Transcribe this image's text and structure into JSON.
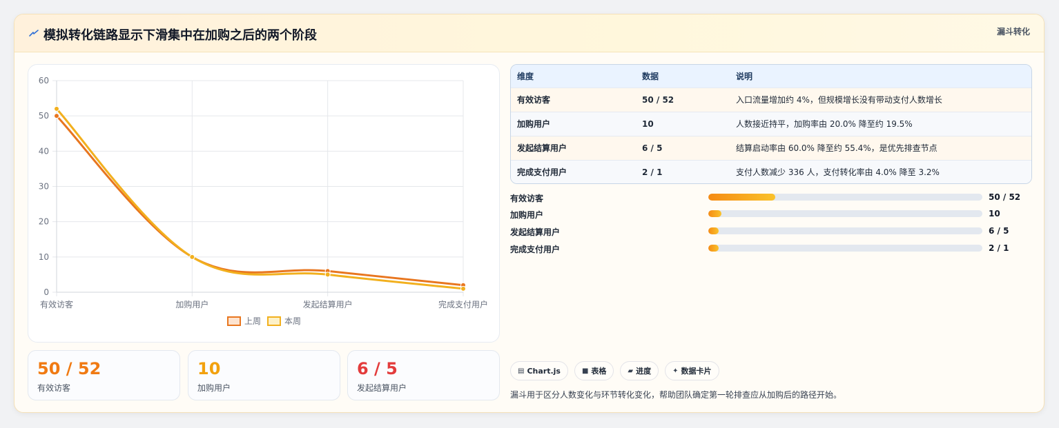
{
  "header": {
    "title": "模拟转化链路显示下滑集中在加购之后的两个阶段",
    "tag": "漏斗转化",
    "icon": "lightning-icon"
  },
  "colors": {
    "last_week": "#e8761f",
    "this_week": "#f2b01e",
    "metric_1": "#f07a12",
    "metric_2": "#f2a10d",
    "metric_3": "#e33c3c"
  },
  "chart_data": {
    "type": "line",
    "categories": [
      "有效访客",
      "加购用户",
      "发起结算用户",
      "完成支付用户"
    ],
    "series": [
      {
        "name": "上周",
        "values": [
          50,
          10,
          6,
          2
        ]
      },
      {
        "name": "本周",
        "values": [
          52,
          10,
          5,
          1
        ]
      }
    ],
    "ylim": [
      0,
      60
    ],
    "yticks": [
      0,
      10,
      20,
      30,
      40,
      50,
      60
    ],
    "grid": true,
    "legend": "bottom"
  },
  "metrics": [
    {
      "value": "50 / 52",
      "label": "有效访客"
    },
    {
      "value": "10",
      "label": "加购用户"
    },
    {
      "value": "6 / 5",
      "label": "发起结算用户"
    }
  ],
  "table": {
    "headers": [
      "维度",
      "数据",
      "说明"
    ],
    "rows": [
      [
        "有效访客",
        "50 / 52",
        "入口流量增加约 4%，但规模增长没有带动支付人数增长"
      ],
      [
        "加购用户",
        "10",
        "人数接近持平，加购率由 20.0% 降至约 19.5%"
      ],
      [
        "发起结算用户",
        "6 / 5",
        "结算启动率由 60.0% 降至约 55.4%，是优先排查节点"
      ],
      [
        "完成支付用户",
        "2 / 1",
        "支付人数减少 336 人，支付转化率由 4.0% 降至 3.2%"
      ]
    ]
  },
  "progress": [
    {
      "label": "有效访客",
      "value": "50 / 52",
      "fraction": 0.245
    },
    {
      "label": "加购用户",
      "value": "10",
      "fraction": 0.048
    },
    {
      "label": "发起结算用户",
      "value": "6 / 5",
      "fraction": 0.037
    },
    {
      "label": "完成支付用户",
      "value": "2 / 1",
      "fraction": 0.037
    }
  ],
  "tags": [
    {
      "icon": "chart-icon",
      "label": "Chart.js"
    },
    {
      "icon": "table-icon",
      "label": "表格"
    },
    {
      "icon": "progress-icon",
      "label": "进度"
    },
    {
      "icon": "sparkle-icon",
      "label": "数据卡片"
    }
  ],
  "footer_note": "漏斗用于区分人数变化与环节转化变化，帮助团队确定第一轮排查应从加购后的路径开始。"
}
